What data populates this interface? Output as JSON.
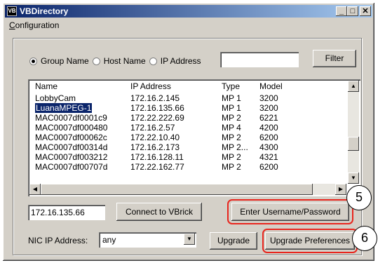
{
  "window": {
    "title": "VBDirectory",
    "icon_text": "VB",
    "controls": {
      "minimize": "_",
      "maximize": "□",
      "close": "✕"
    }
  },
  "menu": {
    "configuration_first": "C",
    "configuration_rest": "onfiguration"
  },
  "search": {
    "options": [
      {
        "label": "Group Name",
        "selected": true
      },
      {
        "label": "Host Name",
        "selected": false
      },
      {
        "label": "IP Address",
        "selected": false
      }
    ],
    "filter_value": "",
    "filter_button": "Filter"
  },
  "devices": {
    "columns": [
      "Name",
      "IP Address",
      "Type",
      "Model"
    ],
    "rows": [
      [
        "LobbyCam",
        "172.16.2.145",
        "MP 1",
        "3200"
      ],
      [
        "LuanaMPEG-1",
        "172.16.135.66",
        "MP 1",
        "3200"
      ],
      [
        "MAC0007df0001c9",
        "172.22.222.69",
        "MP 2",
        "6221"
      ],
      [
        "MAC0007df000480",
        "172.16.2.57",
        "MP 4",
        "4200"
      ],
      [
        "MAC0007df00062c",
        "172.22.10.40",
        "MP 2",
        "6200"
      ],
      [
        "MAC0007df00314d",
        "172.16.2.173",
        "MP 2...",
        "4300"
      ],
      [
        "MAC0007df003212",
        "172.16.128.11",
        "MP 2",
        "4321"
      ],
      [
        "MAC0007df00707d",
        "172.22.162.77",
        "MP 2",
        "6200"
      ]
    ],
    "selected_row": 1
  },
  "connect": {
    "ip_value": "172.16.135.66",
    "connect_button": "Connect to VBrick",
    "credentials_button": "Enter Username/Password"
  },
  "nic": {
    "label": "NIC IP Address:",
    "value": "any",
    "upgrade_button": "Upgrade",
    "preferences_button": "Upgrade Preferences"
  },
  "callouts": {
    "step5": "5",
    "step6": "6"
  },
  "colors": {
    "highlight": "#e8261e",
    "title_start": "#0a246a",
    "title_end": "#a6caf0"
  }
}
